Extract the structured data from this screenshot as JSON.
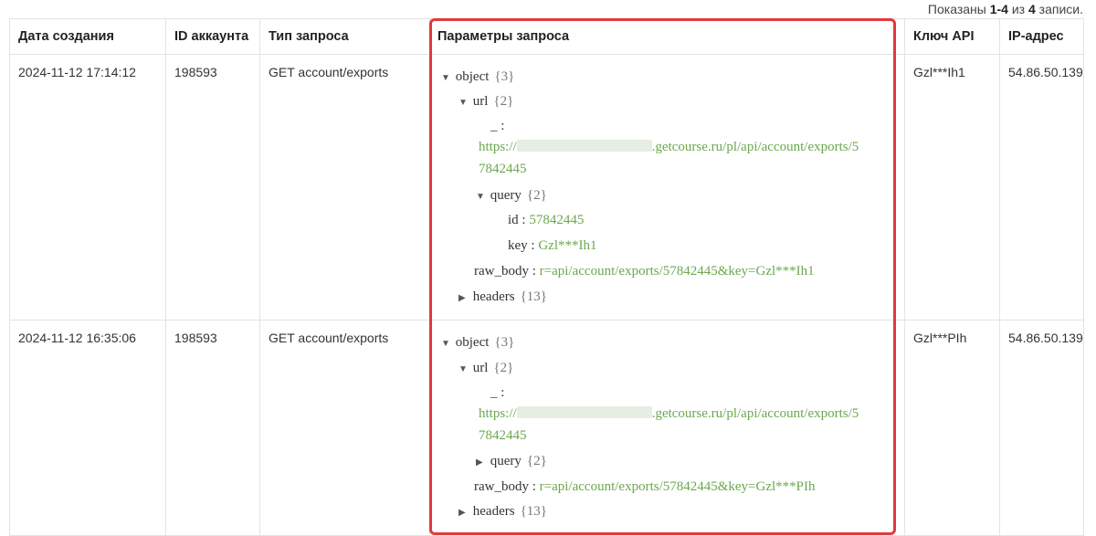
{
  "summary": {
    "prefix": "Показаны",
    "range": "1-4",
    "of": "из",
    "total": "4",
    "suffix": "записи."
  },
  "columns": [
    "Дата создания",
    "ID аккаунта",
    "Тип запроса",
    "Параметры запроса",
    "Ключ API",
    "IP-адрес"
  ],
  "rows": [
    {
      "created": "2024-11-12 17:14:12",
      "account_id": "198593",
      "request_type": "GET account/exports",
      "api_key": "Gzl***Ih1",
      "ip": "54.86.50.139",
      "params": {
        "object_label": "object",
        "object_count": "{3}",
        "url_label": "url",
        "url_count": "{2}",
        "underscore_label": "_ :",
        "url_value_start": "https://",
        "url_value_end": ".getcourse.ru/pl/api/account/exports/5",
        "url_value_wrap": "7842445",
        "query_label": "query",
        "query_count": "{2}",
        "id_label": "id :",
        "id_value": "57842445",
        "key_label": "key :",
        "key_value": "Gzl***Ih1",
        "raw_label": "raw_body :",
        "raw_value": "r=api/account/exports/57842445&key=Gzl***Ih1",
        "headers_label": "headers",
        "headers_count": "{13}"
      }
    },
    {
      "created": "2024-11-12 16:35:06",
      "account_id": "198593",
      "request_type": "GET account/exports",
      "api_key": "Gzl***PIh",
      "ip": "54.86.50.139",
      "params": {
        "object_label": "object",
        "object_count": "{3}",
        "url_label": "url",
        "url_count": "{2}",
        "underscore_label": "_ :",
        "url_value_start": "https://",
        "url_value_end": ".getcourse.ru/pl/api/account/exports/5",
        "url_value_wrap": "7842445",
        "query_label": "query",
        "query_count": "{2}",
        "raw_label": "raw_body :",
        "raw_value": "r=api/account/exports/57842445&key=Gzl***PIh",
        "headers_label": "headers",
        "headers_count": "{13}"
      }
    }
  ]
}
